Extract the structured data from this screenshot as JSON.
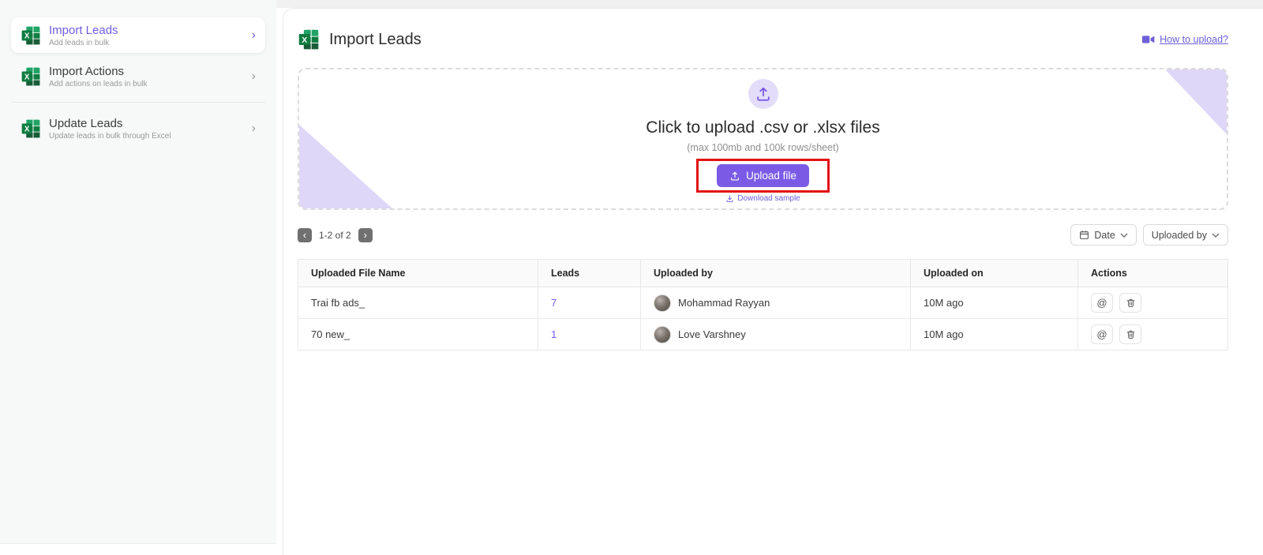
{
  "sidebar": {
    "items": [
      {
        "title": "Import Leads",
        "subtitle": "Add leads in bulk"
      },
      {
        "title": "Import Actions",
        "subtitle": "Add actions on leads in bulk"
      },
      {
        "title": "Update Leads",
        "subtitle": "Update leads in bulk through Excel"
      }
    ]
  },
  "header": {
    "title": "Import Leads",
    "help_link": "How to upload?"
  },
  "dropzone": {
    "heading": "Click to upload .csv or .xlsx files",
    "subheading": "(max 100mb and 100k rows/sheet)",
    "upload_button": "Upload file",
    "download_sample": "Download sample"
  },
  "toolbar": {
    "pagination": "1-2 of 2",
    "date_filter": "Date",
    "uploaded_by_filter": "Uploaded by"
  },
  "table": {
    "columns": [
      "Uploaded File Name",
      "Leads",
      "Uploaded by",
      "Uploaded on",
      "Actions"
    ],
    "rows": [
      {
        "file_name": "Trai fb ads_",
        "leads": "7",
        "uploaded_by": "Mohammad Rayyan",
        "uploaded_on": "10M ago"
      },
      {
        "file_name": "70 new_",
        "leads": "1",
        "uploaded_by": "Love Varshney",
        "uploaded_on": "10M ago"
      }
    ]
  },
  "icons": {
    "chevron_right": "›",
    "chevron_left": "‹",
    "at_sign": "@"
  },
  "colors": {
    "accent_purple": "#7b5be6",
    "link_purple": "#6d5fd8",
    "lavender": "#ded7f8",
    "highlight_red": "#e31212",
    "excel_green": "#107c41"
  }
}
